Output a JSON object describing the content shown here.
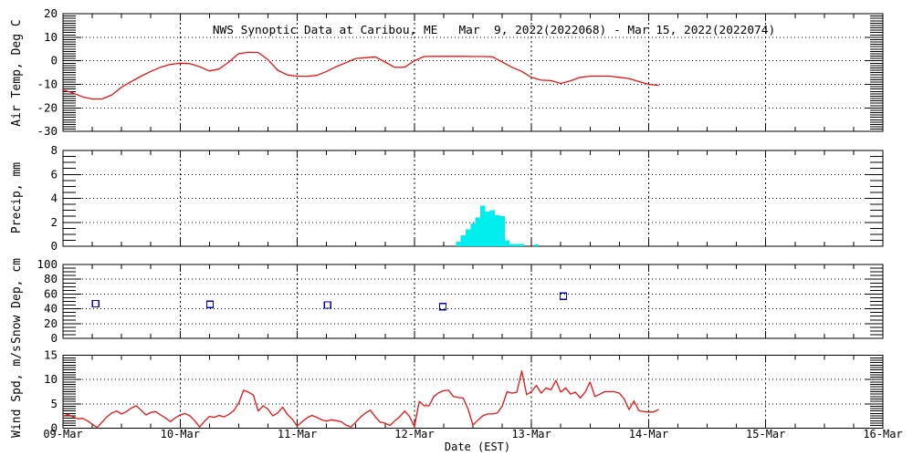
{
  "chart_data": {
    "type": "meteogram",
    "title": "NWS Synoptic Data at Caribou, ME   Mar  9, 2022(2022068) - Mar 15, 2022(2022074)",
    "station": "Caribou, ME",
    "period": {
      "start": "Mar 9, 2022 (2022068)",
      "end": "Mar 15, 2022 (2022074)"
    },
    "x_axis": {
      "label": "Date (EST)",
      "tick_labels": [
        "09-Mar",
        "10-Mar",
        "11-Mar",
        "12-Mar",
        "13-Mar",
        "14-Mar",
        "15-Mar",
        "16-Mar"
      ],
      "hour_reference": "hour 0 = 09-Mar 00:00 EST",
      "range_hours": [
        0,
        168
      ],
      "minor_tick_hours": 6,
      "day_gridlines": true
    },
    "panels": [
      {
        "name": "air-temp",
        "type": "line",
        "ylabel": "Air Temp, Deg C",
        "ylim": [
          -30,
          20
        ],
        "yticks": [
          20,
          10,
          0,
          -10,
          -20,
          -30
        ],
        "grid_yticks": [
          10,
          0,
          -10,
          -20
        ],
        "minor_step": 1,
        "color": "#ee1111",
        "series": {
          "start_hour": 0,
          "step_hours": 2,
          "values": [
            -12.4,
            -13.6,
            -15.3,
            -16.2,
            -16.2,
            -14.5,
            -11.2,
            -8.8,
            -6.5,
            -4.5,
            -2.7,
            -1.5,
            -1.0,
            -1.2,
            -2.5,
            -4.3,
            -3.5,
            -0.5,
            3.0,
            3.6,
            3.5,
            0.5,
            -4.0,
            -6.0,
            -6.5,
            -6.6,
            -6.2,
            -4.5,
            -2.5,
            -0.8,
            1.0,
            1.3,
            1.7,
            -0.5,
            -2.8,
            -2.7,
            0.0,
            1.8,
            1.9,
            1.9,
            1.9,
            1.9,
            1.8,
            1.8,
            1.7,
            -0.5,
            -2.7,
            -4.5,
            -7.0,
            -8.2,
            -8.4,
            -9.6,
            -8.5,
            -7.0,
            -6.5,
            -6.5,
            -6.5,
            -7.0,
            -7.5,
            -8.8,
            -10.0,
            -10.4
          ]
        }
      },
      {
        "name": "precip",
        "type": "bar",
        "ylabel": "Precip, mm",
        "ylim": [
          0,
          8
        ],
        "yticks": [
          8,
          6,
          4,
          2,
          0
        ],
        "grid_yticks": [
          6,
          4,
          2
        ],
        "minor_step": 0.5,
        "color": "#00eeee",
        "bars": [
          {
            "hour": 81,
            "mm": 0.4
          },
          {
            "hour": 82,
            "mm": 0.9
          },
          {
            "hour": 83,
            "mm": 1.4
          },
          {
            "hour": 84,
            "mm": 1.9
          },
          {
            "hour": 85,
            "mm": 2.4
          },
          {
            "hour": 86,
            "mm": 3.4
          },
          {
            "hour": 87,
            "mm": 2.9
          },
          {
            "hour": 88,
            "mm": 3.0
          },
          {
            "hour": 89,
            "mm": 2.6
          },
          {
            "hour": 90,
            "mm": 2.5
          },
          {
            "hour": 91,
            "mm": 0.5
          },
          {
            "hour": 92,
            "mm": 0.2
          },
          {
            "hour": 93,
            "mm": 0.2
          },
          {
            "hour": 94,
            "mm": 0.2
          },
          {
            "hour": 97,
            "mm": 0.15
          }
        ]
      },
      {
        "name": "snow-depth",
        "type": "scatter",
        "marker": "open-square",
        "ylabel": "Snow Dep, cm",
        "ylim": [
          0,
          100
        ],
        "yticks": [
          100,
          80,
          60,
          40,
          20,
          0
        ],
        "grid_yticks": [
          80,
          60,
          40,
          20
        ],
        "minor_step": 5,
        "color": "#0000cc",
        "points": [
          {
            "hour": 6.7,
            "cm": 47
          },
          {
            "hour": 30.1,
            "cm": 46
          },
          {
            "hour": 54.2,
            "cm": 45
          },
          {
            "hour": 77.8,
            "cm": 43
          },
          {
            "hour": 102.5,
            "cm": 57
          }
        ]
      },
      {
        "name": "wind-speed",
        "type": "line",
        "ylabel": "Wind Spd, m/s",
        "ylim": [
          0,
          15
        ],
        "yticks": [
          15,
          10,
          5,
          0
        ],
        "grid_yticks": [
          10,
          5
        ],
        "minor_step": 0.5,
        "color": "#ee1111",
        "series": {
          "start_hour": 0,
          "step_hours": 1,
          "values": [
            2.4,
            2.8,
            2.3,
            1.9,
            2.0,
            1.5,
            0.8,
            0.1,
            1.2,
            2.3,
            3.1,
            3.5,
            2.9,
            3.4,
            4.1,
            4.6,
            3.7,
            2.7,
            3.2,
            3.4,
            2.7,
            2.1,
            1.3,
            2.1,
            2.7,
            3.0,
            2.5,
            1.5,
            0.2,
            1.4,
            2.4,
            2.2,
            2.6,
            2.3,
            2.8,
            3.6,
            5.1,
            7.8,
            7.4,
            6.8,
            3.5,
            4.6,
            3.9,
            2.5,
            3.1,
            4.3,
            2.8,
            1.8,
            0.4,
            1.3,
            2.1,
            2.6,
            2.2,
            1.7,
            1.4,
            1.7,
            1.5,
            1.3,
            0.6,
            0.2,
            1.2,
            2.3,
            3.1,
            3.7,
            2.3,
            1.2,
            1.0,
            0.5,
            1.5,
            2.3,
            3.5,
            2.4,
            0.3,
            5.5,
            4.6,
            4.6,
            6.5,
            7.3,
            7.7,
            7.8,
            6.5,
            6.3,
            6.2,
            3.9,
            0.6,
            1.6,
            2.5,
            2.9,
            2.9,
            3.1,
            4.5,
            7.5,
            7.2,
            7.4,
            11.8,
            6.9,
            7.5,
            8.8,
            7.2,
            8.3,
            7.9,
            9.8,
            7.4,
            8.3,
            7.0,
            7.4,
            6.2,
            7.4,
            9.5,
            6.5,
            7.0,
            7.5,
            7.5,
            7.5,
            7.2,
            6.0,
            3.8,
            5.6,
            3.6,
            3.4,
            3.3,
            3.3,
            3.8
          ]
        }
      }
    ]
  }
}
